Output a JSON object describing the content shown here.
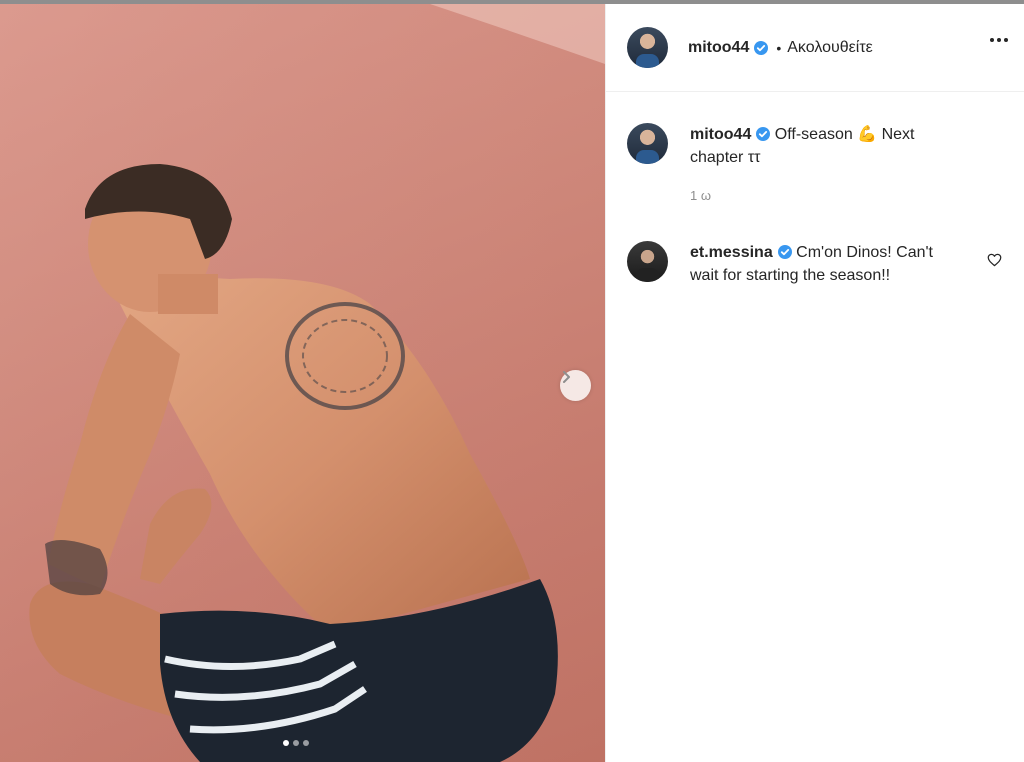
{
  "post": {
    "username": "mitoo44",
    "separator": "•",
    "follow_label": "Ακολουθείτε",
    "caption_user": "mitoo44",
    "caption_text_part1": "Off-season ",
    "caption_emoji": "💪",
    "caption_text_part2": " Next chapter ",
    "caption_symbol": "ττ",
    "time_ago": "1 ω"
  },
  "comments": [
    {
      "username": "et.messina",
      "text": "Cm'on Dinos! Can't wait for starting the season!!"
    }
  ],
  "carousel": {
    "slide_count": 3,
    "active_index": 0
  },
  "colors": {
    "accent_blue": "#3897f0",
    "text": "#262626",
    "muted": "#8e8e8e"
  },
  "icons": [
    "verified-badge-icon",
    "more-options-icon",
    "chevron-right-icon",
    "heart-icon"
  ]
}
